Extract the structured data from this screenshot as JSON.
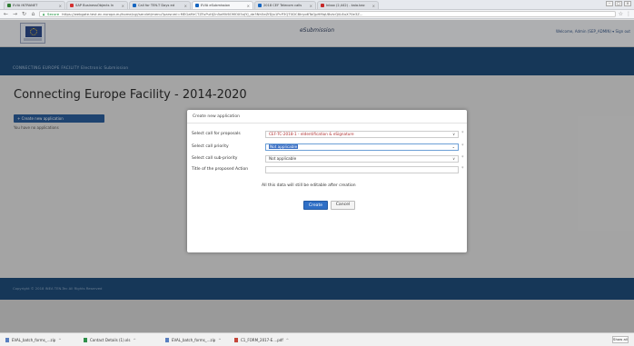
{
  "browser": {
    "tabs": [
      {
        "label": "EVIA INTRANET",
        "color": "#2e7d32"
      },
      {
        "label": "SAP BusinessObjects In",
        "color": "#d32f2f"
      },
      {
        "label": "Call for TEN-T Days ed",
        "color": "#1565c0"
      },
      {
        "label": "EVIA eSubmission",
        "color": "#1565c0"
      },
      {
        "label": "2018 CEF Telecom calls",
        "color": "#1565c0"
      },
      {
        "label": "Inbox (2,442) - kaia.bac",
        "color": "#c62828"
      }
    ],
    "secure_label": "Secure",
    "url": "https://webgate.test.ec.europa.eu/home/cgi/servlet/menu?parsnml=MEGaMrCTZFuPuHJ2n5aMV6OMOX5xJYJ_de3Nh5eZfDjx1PcP3QT0DC8tryo6TaQpHMqU8vtcQiiL6uX70e3Z...",
    "window_controls": [
      "–",
      "□",
      "×"
    ]
  },
  "header": {
    "brand": "eSubmission",
    "welcome": "Welcome, Admin (SEP_ADMIN) ▾  Sign out"
  },
  "bluebar": {
    "subtitle": "CONNECTING EUROPE FACILITY Electronic Submission"
  },
  "page": {
    "title": "Connecting Europe Facility - 2014-2020",
    "create_button": "+ Create new application",
    "no_apps": "You have no applications"
  },
  "footer": {
    "copyright": "Copyright © 2018 INEA TEN-Tec All Rights Reserved"
  },
  "modal": {
    "title": "Create new application",
    "fields": [
      {
        "label": "Select call for proposals",
        "value": "CEF-TC-2018-1 - eIdentification & eSignature",
        "required": "*"
      },
      {
        "label": "Select call priority",
        "value": "Not applicable",
        "required": "*"
      },
      {
        "label": "Select call sub-priority",
        "value": "Not applicable",
        "required": "*"
      },
      {
        "label": "Title of the proposed Action",
        "value": "",
        "required": "*"
      }
    ],
    "note": "All this data will still be editable after creation",
    "create_label": "Create",
    "cancel_label": "Cancel"
  },
  "downloads": {
    "items": [
      {
        "name": "EVAL_batch_forms_...zip"
      },
      {
        "name": "Contact Details (1).xls"
      },
      {
        "name": "EVAL_batch_forms_...zip"
      },
      {
        "name": "C1_FORM_2017-E....pdf"
      }
    ],
    "show_all": "Show all"
  }
}
